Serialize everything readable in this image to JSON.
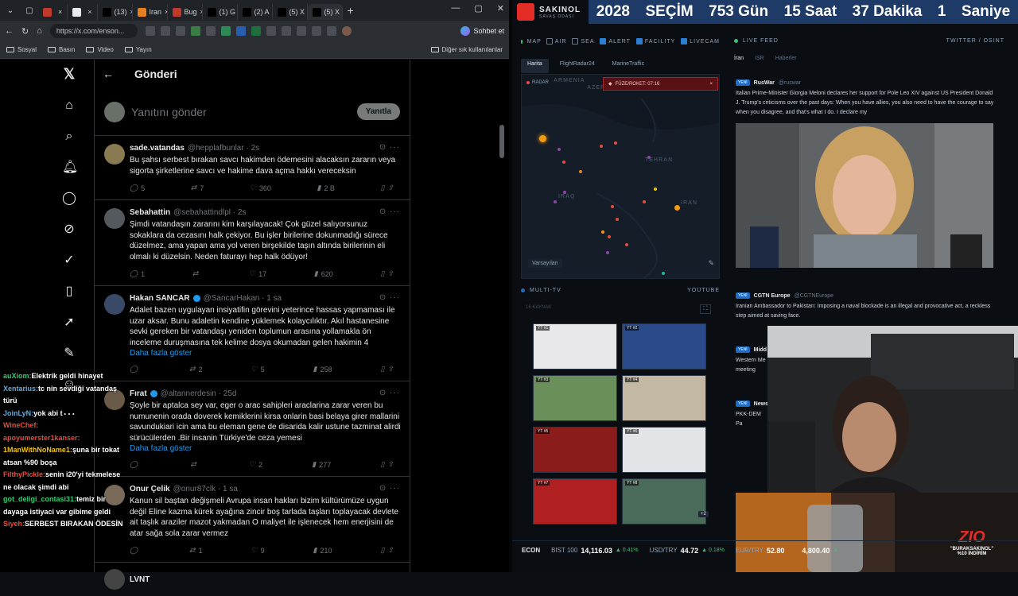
{
  "browser": {
    "tabs": [
      {
        "label": "",
        "favicon": "#c0392b"
      },
      {
        "label": "",
        "favicon": "#e7e9ea"
      },
      {
        "label": "(13)",
        "favicon": "#000000"
      },
      {
        "label": "Iran",
        "favicon": "#e67e22"
      },
      {
        "label": "Bug",
        "favicon": "#c0392b"
      },
      {
        "label": "(1) G",
        "favicon": "#000000"
      },
      {
        "label": "(2) A",
        "favicon": "#000000"
      },
      {
        "label": "(5) X",
        "favicon": "#000000"
      },
      {
        "label": "(5) X",
        "favicon": "#000000"
      }
    ],
    "url": "https://x.com/enson...",
    "chat_label": "Sohbet et",
    "bookmarks": [
      "Sosyal",
      "Basın",
      "Video",
      "Yayın"
    ],
    "bookmarks_right": "Diğer sık kullanılanlar"
  },
  "x": {
    "header_title": "Gönderi",
    "reply_placeholder": "Yanıtını gönder",
    "reply_button": "Yanıtla",
    "tweets": [
      {
        "name": "sade.vatandas",
        "handle": "@hepplafbunlar · 2s",
        "text": "Bu şahsı serbest bırakan savcı hakimden ödemesini alacaksın zararın veya sigorta şirketlerine savcı ve hakime dava açma hakkı vereceksin",
        "more": "",
        "replies": "5",
        "reposts": "7",
        "likes": "360",
        "views": "2 B",
        "avatar": "#8a7a52"
      },
      {
        "name": "Sebahattin",
        "handle": "@sebahattindlpl · 2s",
        "text": "Şimdi vatandaşın zararını kim karşılayacak! Çok güzel salıyorsunuz sokaklara da cezasını halk çekiyor. Bu işler birilerine dokunmadığı sürece düzelmez, ama yapan ama yol veren birşekilde taşın altında birilerinin eli olmalı ki düzelsin. Neden faturayı hep halk ödüyor!",
        "more": "",
        "replies": "1",
        "reposts": "",
        "likes": "17",
        "views": "620",
        "avatar": "#55595e"
      },
      {
        "name": "Hakan SANCAR",
        "handle": "@SancarHakan · 1 sa",
        "text": "Adalet bazen uygulayan insiyatifin görevini yeterince hassas yapmaması ile uzar aksar. Bunu adaletin kendine yüklemek kolaycılıktır. Akıl hastanesine sevki gereken bir vatandaşı yeniden toplumun arasına yollamakla ön inceleme  duruşmasına tek kelime dosya okumadan gelen hakimin 4",
        "more": "Daha fazla göster",
        "replies": "",
        "reposts": "2",
        "likes": "5",
        "views": "258",
        "avatar": "#3a4a66"
      },
      {
        "name": "Fırat",
        "handle": "@altannerdesin · 25d",
        "text": "Şoyle bir aptalca sey var, eger o arac sahipleri araclarina zarar veren bu numunenin orada doverek kemiklerini kirsa onlarin basi belaya girer mallarini savundukiari icin ama bu eleman gene de disarida kalir ustune tazminat alirdi sürücülerden .Bir insanin Türkiye'de ceza yemesi",
        "more": "Daha fazla göster",
        "replies": "",
        "reposts": "",
        "likes": "2",
        "views": "277",
        "avatar": "#6a5a48"
      },
      {
        "name": "Onur Çelik",
        "handle": "@onur87clk · 1 sa",
        "text": "Kanun sil baştan değişmeli Avrupa insan hakları bizim kültürümüze uygun değil Eline kazma kürek ayağına zincir boş tarlada taşları toplayacak devlete ait taşlık araziler mazot yakmadan O maliyet ile işlenecek hem enerjisini de atar sağa sola zarar vermez",
        "more": "",
        "replies": "",
        "reposts": "1",
        "likes": "9",
        "views": "210",
        "avatar": "#7a6a5a"
      }
    ],
    "next_tweet_name": "LVNT"
  },
  "chat": [
    {
      "user": "auXiom:",
      "msg": "Elektrik geldi hinayet",
      "color": "#2ecc71"
    },
    {
      "user": "",
      "msg": "",
      "color": "#ffffff"
    },
    {
      "user": "Xentarius:",
      "msg": "tc nin sevdiği vatandaş türü",
      "color": "#5dade2"
    },
    {
      "user": "JoinLyN:",
      "msg": "yok abi t",
      "color": "#5dade2"
    },
    {
      "user": "WineChef:",
      "msg": "",
      "color": "#e74c3c"
    },
    {
      "user": "apoyumerster1kanser:",
      "msg": "",
      "color": "#e74c3c"
    },
    {
      "user": "1ManWithNoName1:",
      "msg": "şuna bir tokat atsan %90 boşa",
      "color": "#f1c40f"
    },
    {
      "user": "FilthyPickle:",
      "msg": "senin i20'yi tekmelese ne olacak şimdi abi",
      "color": "#e74c3c"
    },
    {
      "user": "got_deligi_contasi31:",
      "msg": "temiz bir dayaga istiyaci var gibime geldi",
      "color": "#2ecc71"
    },
    {
      "user": "Siyeh:",
      "msg": "SERBEST BIRAKAN ÖDESİN",
      "color": "#e74c3c"
    }
  ],
  "dashboard": {
    "logo_title": "SAKINOL",
    "logo_sub": "SAVAŞ ODASI",
    "countdown": [
      "2028",
      "SEÇİM",
      "753 Gün",
      "15 Saat",
      "37 Dakika",
      "1",
      "Saniye"
    ],
    "map_title": "MAP",
    "layers": [
      {
        "label": "AIR",
        "on": false
      },
      {
        "label": "SEA",
        "on": false
      },
      {
        "label": "ALERT",
        "on": true
      },
      {
        "label": "FACILITY",
        "on": true
      },
      {
        "label": "LIVECAM",
        "on": true
      }
    ],
    "map_tabs": [
      "Harita",
      "FlightRadar24",
      "MarineTraffic"
    ],
    "radar_label": "RADAR",
    "alert_text": "FÜZE/ROKET: 07:16",
    "map_labels": [
      "ARMENIA",
      "AZER",
      "TEHRAN",
      "IRAQ",
      "IRAN"
    ],
    "preset_label": "Varsayılan",
    "multitv_title": "MULTI-TV",
    "multitv_right": "YOUTUBE",
    "sources_label": "16 KAYNAK",
    "video_tags": [
      "YT #1",
      "YT #2",
      "YT #3",
      "YT #4",
      "YT #5",
      "YT #6",
      "YT #7",
      "YT #8"
    ],
    "more_count": "+2",
    "feed_title": "LIVE FEED",
    "feed_right": "TWITTER / OSINT",
    "feed_tabs": [
      "İran",
      "ISR",
      "Haberler"
    ],
    "feed": [
      {
        "badge": "YENİ",
        "name": "RusWar",
        "handle": "@ruswar",
        "text": "Italian Prime-Minister Giorgia Meloni declares her support for Pole Leo XIV against US President Donald J. Trump's criticisms over the past days: When you have allies, you also need to have the courage to say when you disagree, and that's what I do. I declare my"
      },
      {
        "badge": "YENİ",
        "name": "CGTN Europe",
        "handle": "@CGTNEurope",
        "text": "Iranian Ambassador to Pakistan: Imposing a naval blockade is an illegal and provocative act, a reckless step aimed at saving face."
      },
      {
        "badge": "YENİ",
        "name": "Midd",
        "handle": "",
        "text": "Western Me meeting"
      },
      {
        "badge": "YENİ",
        "name": "News",
        "handle": "",
        "text": "PKK-DEM Pa"
      }
    ],
    "econ": {
      "label": "ECON",
      "items": [
        {
          "name": "BIST 100",
          "value": "14,116.03",
          "change": "▲ 0.41%"
        },
        {
          "name": "USD/TRY",
          "value": "44.72",
          "change": "▲ 0.18%"
        },
        {
          "name": "EUR/TRY",
          "value": "52.80",
          "change": ""
        },
        {
          "name": "",
          "value": "4,800.40",
          "change": "▲"
        }
      ]
    }
  },
  "stream_brand": {
    "logo": "ZIO",
    "line1": "\"BURAKSAKINOL\"",
    "line2": "%10 İNDİRİM"
  }
}
